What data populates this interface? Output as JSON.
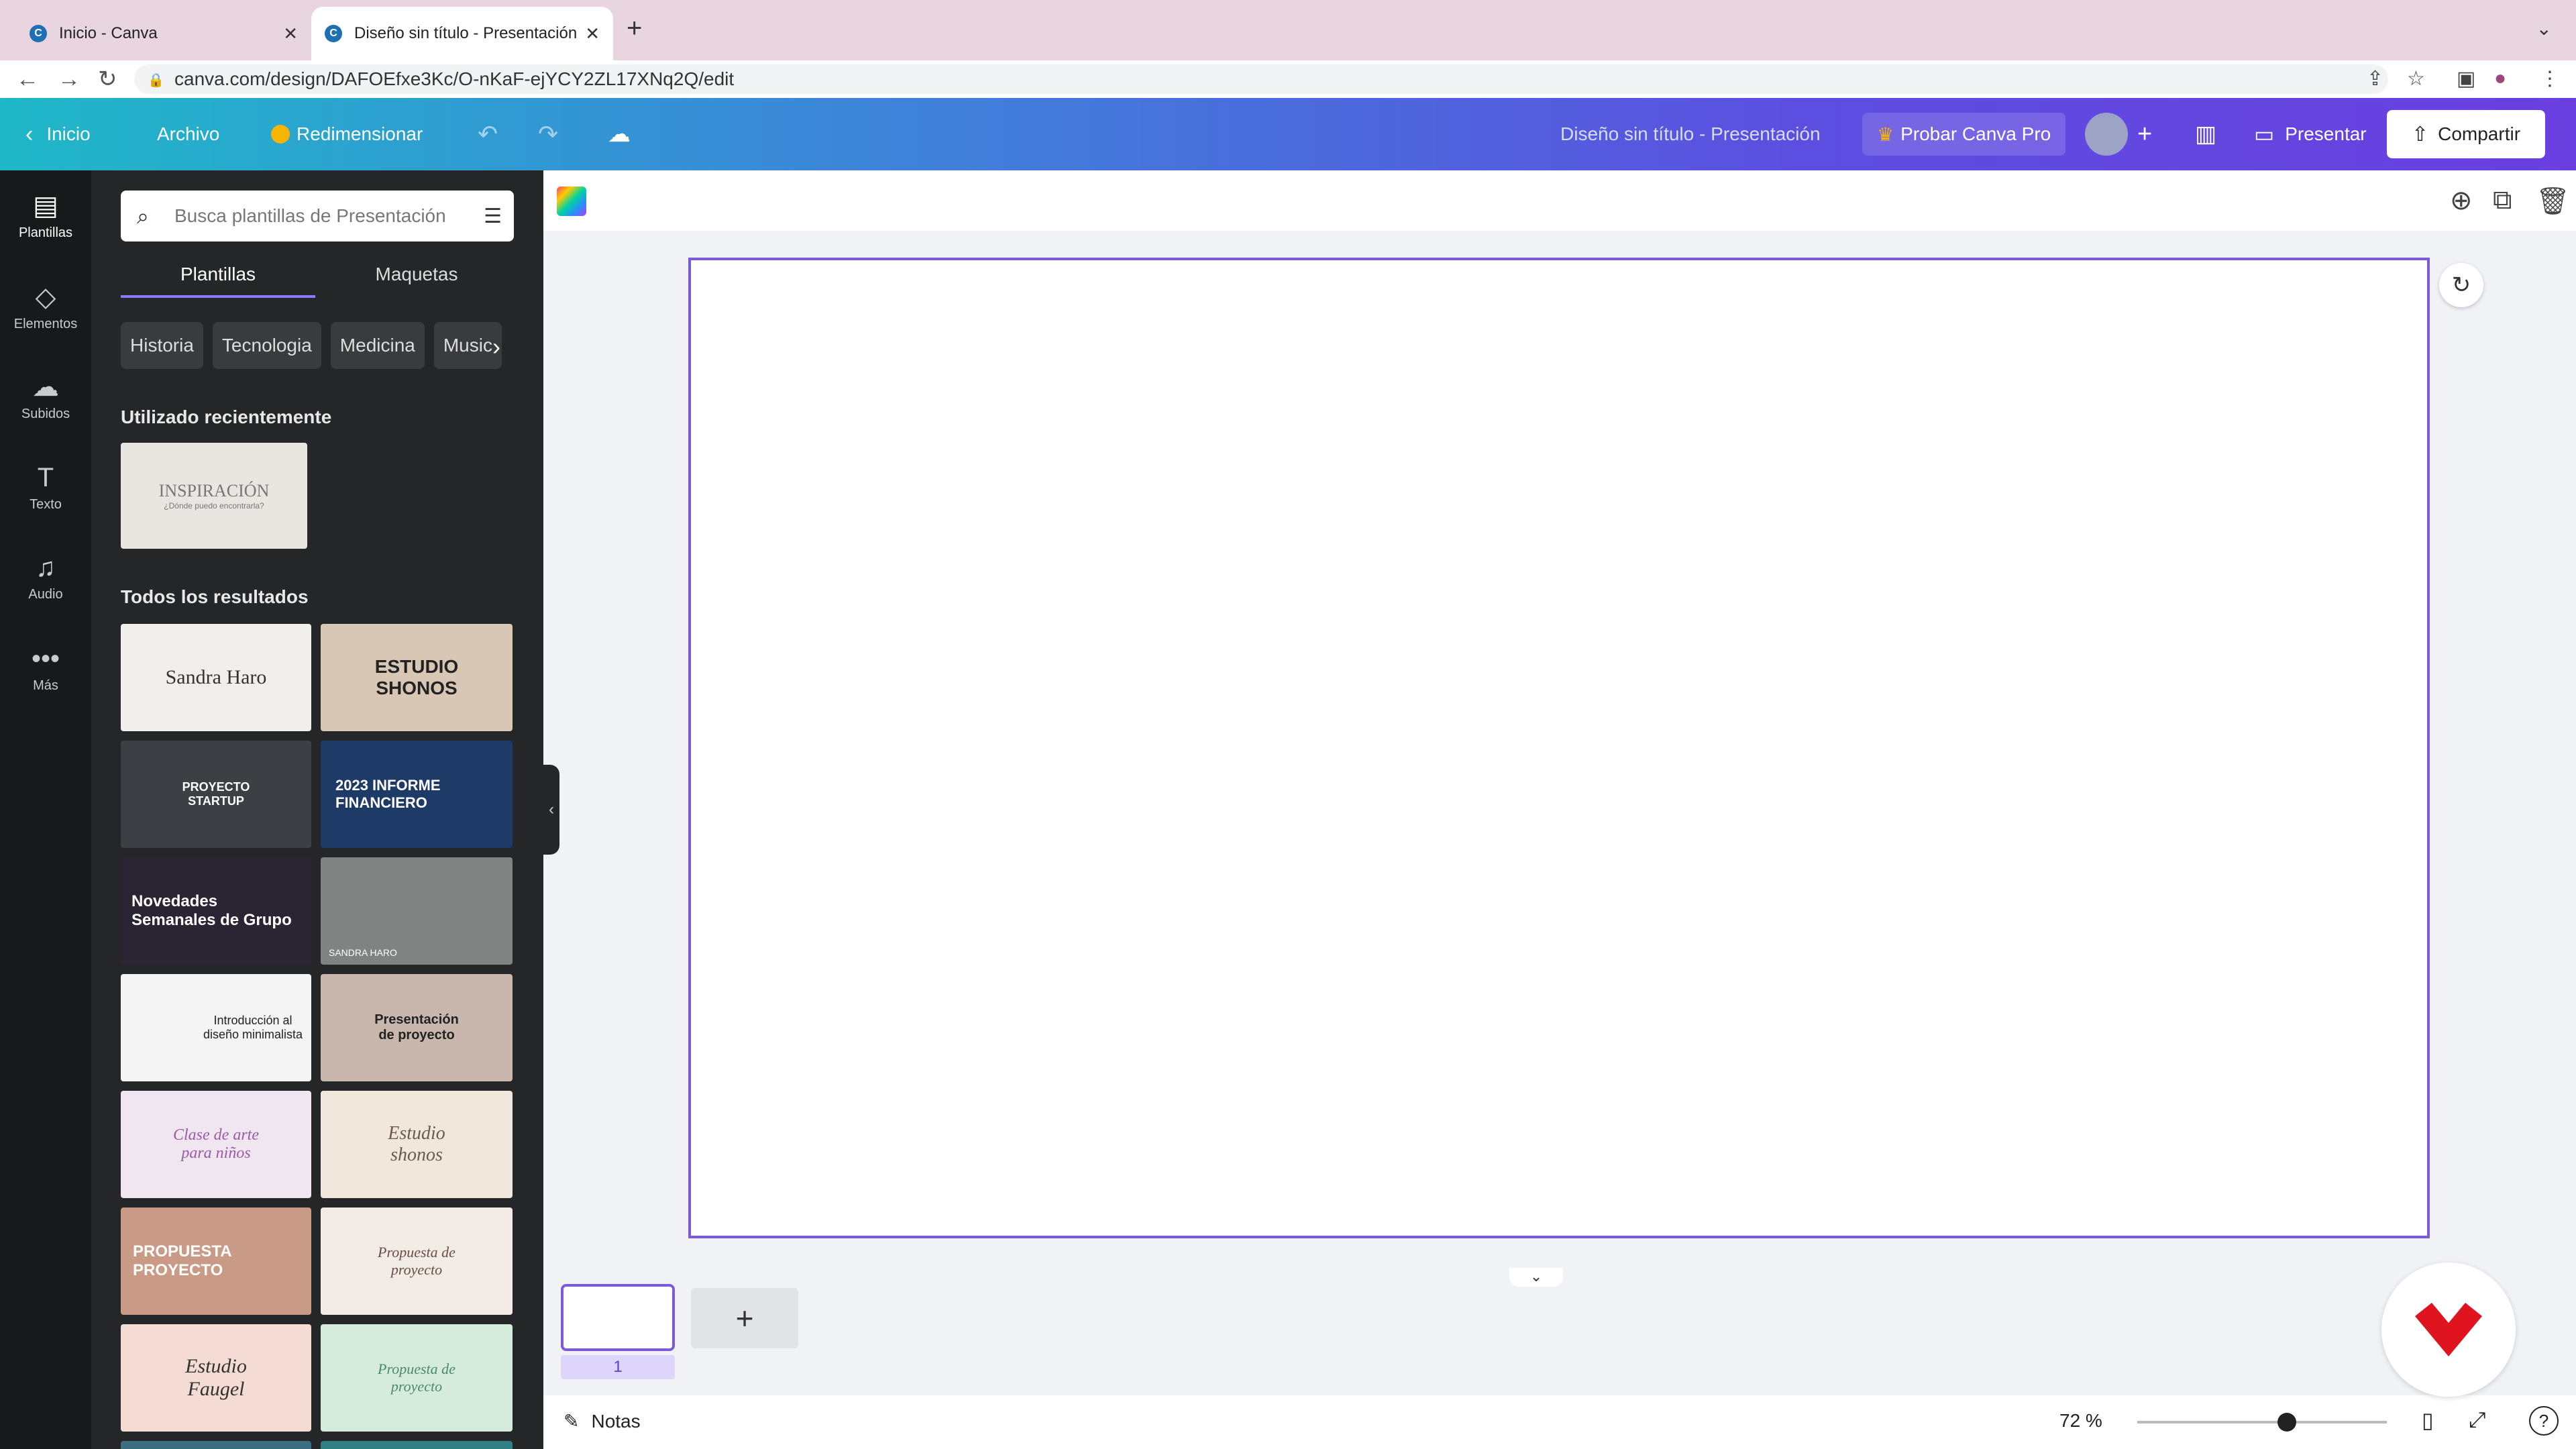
{
  "browser": {
    "tabs": [
      {
        "title": "Inicio - Canva",
        "close": "✕"
      },
      {
        "title": "Diseño sin título - Presentación",
        "close": "✕"
      }
    ],
    "url": "canva.com/design/DAFOEfxe3Kc/O-nKaF-ejYCY2ZL17XNq2Q/edit"
  },
  "header": {
    "back_label": "Inicio",
    "file_label": "Archivo",
    "resize_label": "Redimensionar",
    "design_title": "Diseño sin título - Presentación",
    "pro_label": "Probar Canva Pro",
    "present_label": "Presentar",
    "share_label": "Compartir"
  },
  "rail": [
    {
      "label": "Plantillas",
      "icon": "templates-icon"
    },
    {
      "label": "Elementos",
      "icon": "elements-icon"
    },
    {
      "label": "Subidos",
      "icon": "uploads-icon"
    },
    {
      "label": "Texto",
      "icon": "text-icon"
    },
    {
      "label": "Audio",
      "icon": "audio-icon"
    },
    {
      "label": "Más",
      "icon": "more-icon"
    }
  ],
  "panel": {
    "search_placeholder": "Busca plantillas de Presentación",
    "tabs": [
      "Plantillas",
      "Maquetas"
    ],
    "chips": [
      "Historia",
      "Tecnologia",
      "Medicina",
      "Music"
    ],
    "recent_heading": "Utilizado recientemente",
    "recent_thumb": {
      "title": "INSPIRACIÓN",
      "subtitle": "¿Dónde puedo encontrarla?"
    },
    "results_heading": "Todos los resultados",
    "templates": [
      {
        "text": "Sandra Haro"
      },
      {
        "text": "ESTUDIO SHONOS"
      },
      {
        "text": "PROYECTO STARTUP"
      },
      {
        "text": "2023 INFORME FINANCIERO"
      },
      {
        "text": "Novedades Semanales de Grupo"
      },
      {
        "text": "SANDRA HARO"
      },
      {
        "text": "Introducción al diseño minimalista"
      },
      {
        "text": "Presentación de proyecto"
      },
      {
        "text": "Clase de arte para niños"
      },
      {
        "text": "Estudio shonos"
      },
      {
        "text": "PROPUESTA PROYECTO"
      },
      {
        "text": "Propuesta de proyecto"
      },
      {
        "text": "Estudio Faugel"
      },
      {
        "text": "Propuesta de proyecto"
      }
    ]
  },
  "editor": {
    "slide_number": "1",
    "notes_label": "Notas",
    "zoom_label": "72 %",
    "zoom_level": 0.6
  },
  "colors": {
    "accent": "#7d5bd8",
    "panel_bg": "#252627",
    "rail_bg": "#18191b"
  }
}
